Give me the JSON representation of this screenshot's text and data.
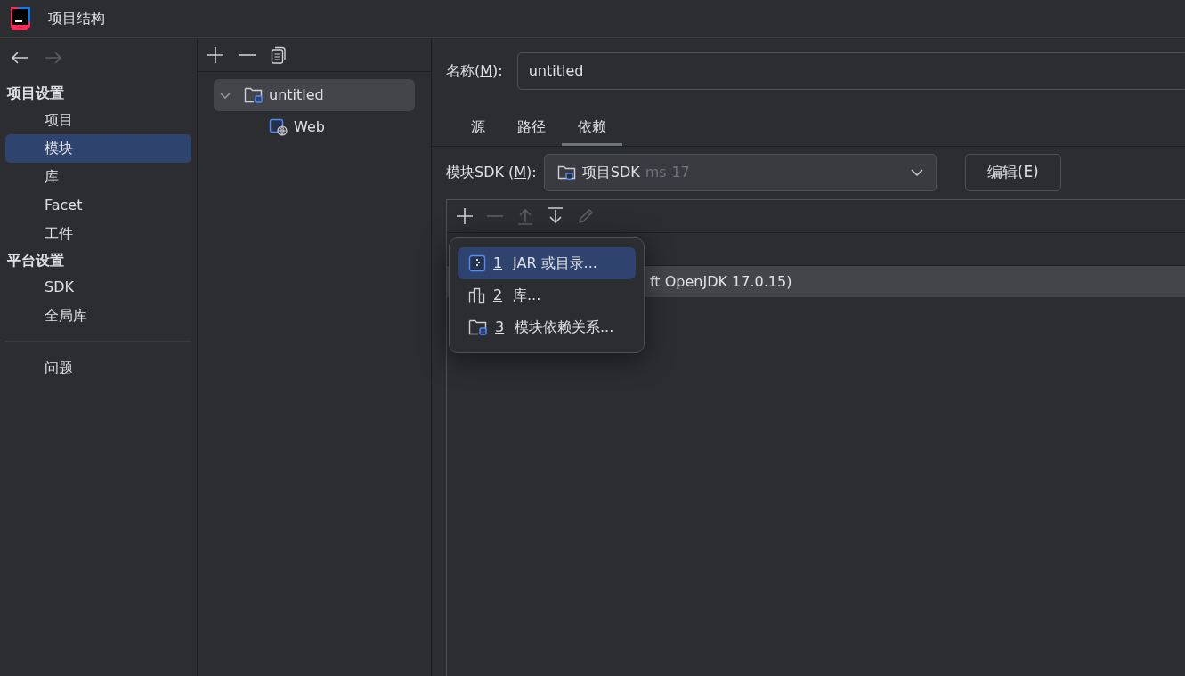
{
  "window": {
    "title": "项目结构"
  },
  "sidebar": {
    "sections": [
      {
        "heading": "项目设置",
        "items": [
          {
            "label": "项目",
            "selected": false
          },
          {
            "label": "模块",
            "selected": true
          },
          {
            "label": "库",
            "selected": false
          },
          {
            "label": "Facet",
            "selected": false
          },
          {
            "label": "工件",
            "selected": false
          }
        ]
      },
      {
        "heading": "平台设置",
        "items": [
          {
            "label": "SDK",
            "selected": false
          },
          {
            "label": "全局库",
            "selected": false
          }
        ]
      }
    ],
    "extra_items": [
      {
        "label": "问题",
        "selected": false
      }
    ]
  },
  "tree": {
    "items": [
      {
        "label": "untitled",
        "kind": "module",
        "expanded": true,
        "selected": true,
        "children": [
          {
            "label": "Web",
            "kind": "web",
            "selected": false
          }
        ]
      }
    ]
  },
  "details": {
    "name_label": [
      "名称(",
      "M",
      "):"
    ],
    "name_value": "untitled",
    "tabs": [
      {
        "label": "源",
        "selected": false
      },
      {
        "label": "路径",
        "selected": false
      },
      {
        "label": "依赖",
        "selected": true
      }
    ],
    "sdk_label": [
      "模块SDK (",
      "M",
      "):"
    ],
    "sdk_value": "项目SDK",
    "sdk_version": "ms-17",
    "edit_button": "编辑(E)",
    "toolbar": [
      {
        "kind": "add",
        "disabled": false
      },
      {
        "kind": "remove",
        "disabled": true
      },
      {
        "kind": "up",
        "disabled": true
      },
      {
        "kind": "down",
        "disabled": false
      },
      {
        "kind": "edit",
        "disabled": true
      }
    ],
    "rows": [
      {
        "text": "ft OpenJDK 17.0.15)",
        "selected": true
      }
    ],
    "popup": [
      {
        "kind": "jar",
        "number": "1",
        "label": "JAR 或目录...",
        "selected": true
      },
      {
        "kind": "library",
        "number": "2",
        "label": "库...",
        "selected": false
      },
      {
        "kind": "module",
        "number": "3",
        "label": "模块依赖关系...",
        "selected": false
      }
    ]
  }
}
